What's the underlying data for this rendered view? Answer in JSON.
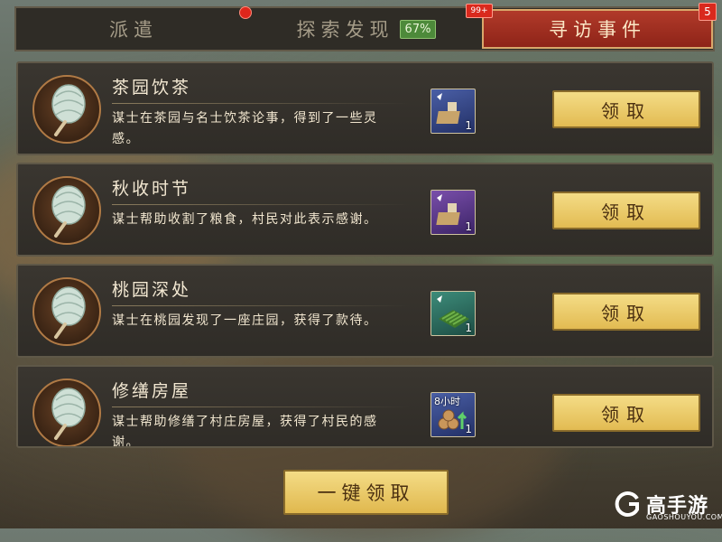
{
  "tabs": {
    "dispatch": "派遣",
    "explore": "探索发现",
    "explore_pct": "67%",
    "visit": "寻访事件",
    "visit_corner_badge": "99+",
    "visit_count": "5"
  },
  "events": [
    {
      "title": "茶园饮茶",
      "desc": "谋士在茶园与名士饮茶论事，得到了一些灵感。",
      "reward_qty": "1",
      "reward_rarity": "blue",
      "claim": "领取"
    },
    {
      "title": "秋收时节",
      "desc": "谋士帮助收割了粮食，村民对此表示感谢。",
      "reward_qty": "1",
      "reward_rarity": "purple",
      "claim": "领取"
    },
    {
      "title": "桃园深处",
      "desc": "谋士在桃园发现了一座庄园，获得了款待。",
      "reward_qty": "1",
      "reward_rarity": "green",
      "claim": "领取"
    },
    {
      "title": "修缮房屋",
      "desc": "谋士帮助修缮了村庄房屋，获得了村民的感谢。",
      "reward_qty": "1",
      "reward_tag": "8小时",
      "reward_rarity": "blue",
      "claim": "领取"
    }
  ],
  "claim_all": "一键领取",
  "watermark": {
    "name": "高手游",
    "url": "GAOSHOUYOU.COM"
  },
  "colors": {
    "accent_red": "#b13a2a",
    "button_gold": "#e2bb52",
    "panel": "#2f2c27"
  }
}
